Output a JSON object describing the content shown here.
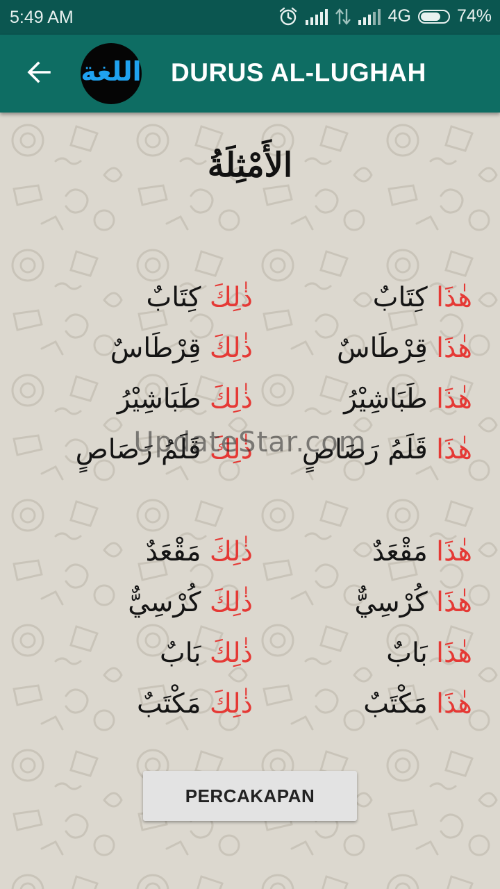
{
  "status_bar": {
    "time": "5:49 AM",
    "network": "4G",
    "battery_percent": "74%",
    "battery_level": 0.74
  },
  "app_bar": {
    "logo_text": "اللغة",
    "title": "DURUS AL-LUGHAH"
  },
  "lesson": {
    "title": "الأَمْثِلَةُ",
    "watermark": "UpdateStar.com",
    "groups": [
      {
        "rows": [
          {
            "near": {
              "demonstrative": "هٰذَا",
              "noun": "كِتَابٌ"
            },
            "far": {
              "demonstrative": "ذٰلِكَ",
              "noun": "كِتَابٌ"
            }
          },
          {
            "near": {
              "demonstrative": "هٰذَا",
              "noun": "قِرْطَاسٌ"
            },
            "far": {
              "demonstrative": "ذٰلِكَ",
              "noun": "قِرْطَاسٌ"
            }
          },
          {
            "near": {
              "demonstrative": "هٰذَا",
              "noun": "طَبَاشِيْرُ"
            },
            "far": {
              "demonstrative": "ذٰلِكَ",
              "noun": "طَبَاشِيْرُ"
            }
          },
          {
            "near": {
              "demonstrative": "هٰذَا",
              "noun": "قَلَمُ رَصَاصٍ"
            },
            "far": {
              "demonstrative": "ذٰلِكَ",
              "noun": "قَلَمُ رَصَاصٍ"
            }
          }
        ]
      },
      {
        "rows": [
          {
            "near": {
              "demonstrative": "هٰذَا",
              "noun": "مَقْعَدٌ"
            },
            "far": {
              "demonstrative": "ذٰلِكَ",
              "noun": "مَقْعَدٌ"
            }
          },
          {
            "near": {
              "demonstrative": "هٰذَا",
              "noun": "كُرْسِيٌّ"
            },
            "far": {
              "demonstrative": "ذٰلِكَ",
              "noun": "كُرْسِيٌّ"
            }
          },
          {
            "near": {
              "demonstrative": "هٰذَا",
              "noun": "بَابٌ"
            },
            "far": {
              "demonstrative": "ذٰلِكَ",
              "noun": "بَابٌ"
            }
          },
          {
            "near": {
              "demonstrative": "هٰذَا",
              "noun": "مَكْتَبٌ"
            },
            "far": {
              "demonstrative": "ذٰلِكَ",
              "noun": "مَكْتَبٌ"
            }
          }
        ]
      }
    ]
  },
  "next_button": {
    "label": "PERCAKAPAN"
  },
  "icons": {
    "back": "arrow-back-icon",
    "alarm": "alarm-icon",
    "signal": "signal-icon",
    "data": "data-transfer-icon",
    "battery": "battery-icon"
  },
  "colors": {
    "status_bar": "#0b5650",
    "app_bar": "#0e6d63",
    "demonstrative": "#e53935",
    "background": "#dcd8cf",
    "logo_text": "#1fa2f0"
  }
}
